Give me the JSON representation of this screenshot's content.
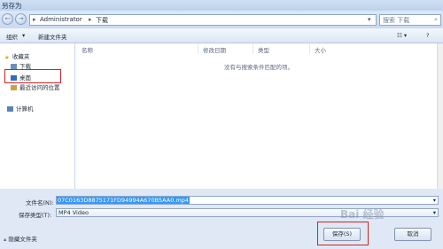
{
  "window": {
    "title": "另存为"
  },
  "nav": {
    "back": "←",
    "forward": "→",
    "path": [
      "Administrator",
      "下载"
    ],
    "search_placeholder": "搜索 下载"
  },
  "toolbar": {
    "organize": "组织",
    "new_folder": "新建文件夹",
    "view": "☷ ▾",
    "help": "?"
  },
  "sidebar": {
    "favorites": "收藏夹",
    "downloads": "下载",
    "desktop": "桌面",
    "recent": "最近访问的位置",
    "computer": "计算机"
  },
  "columns": {
    "name": "名称",
    "date": "修改日期",
    "type": "类型",
    "size": "大小"
  },
  "empty_message": "没有与搜索条件匹配的项。",
  "form": {
    "filename_label": "文件名(N):",
    "filename_value": "07C0163D8875171FD94994A670B5AA0.mp4",
    "filetype_label": "保存类型(T):",
    "filetype_value": "MP4 Video"
  },
  "footer": {
    "hide_folders": "隐藏文件夹",
    "save": "保存(S)",
    "cancel": "取消"
  },
  "watermark": "Bai 经验"
}
